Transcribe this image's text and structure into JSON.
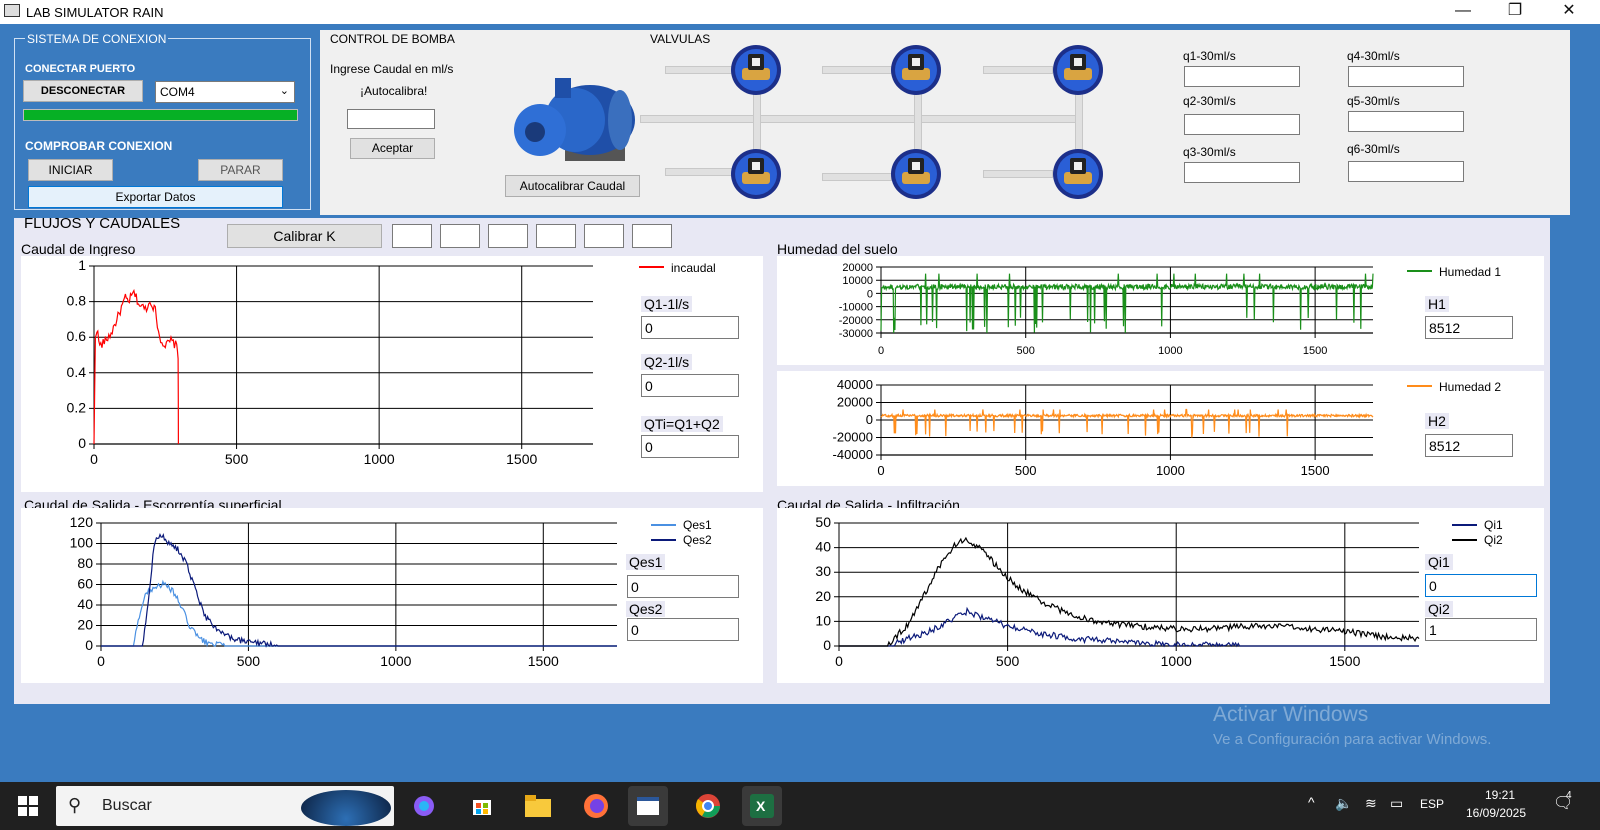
{
  "window": {
    "title": "LAB SIMULATOR RAIN",
    "minimize": "—",
    "restore": "❐",
    "close": "✕"
  },
  "sistema": {
    "group_title": "SISTEMA DE CONEXION",
    "conectar_label": "CONECTAR PUERTO",
    "desconectar_button": "DESCONECTAR",
    "port_selected": "COM4",
    "progress": 1.0,
    "comprobar_label": "COMPROBAR CONEXION",
    "iniciar_button": "INICIAR",
    "parar_button": "PARAR",
    "exportar_button": "Exportar Datos"
  },
  "bomba": {
    "group_title": "CONTROL DE BOMBA",
    "ingrese_label": "Ingrese Caudal en ml/s",
    "autocalibra_label": "¡Autocalibra!",
    "caudal_value": "",
    "aceptar_button": "Aceptar",
    "autocalibrar_button": "Autocalibrar Caudal"
  },
  "valvulas": {
    "group_title": "VALVULAS",
    "labels": [
      "q1-30ml/s",
      "q2-30ml/s",
      "q3-30ml/s",
      "q4-30ml/s",
      "q5-30ml/s",
      "q6-30ml/s"
    ],
    "values": [
      "",
      "",
      "",
      "",
      "",
      ""
    ]
  },
  "flujos": {
    "title": "FLUJOS Y CAUDALES",
    "calibrar_button": "Calibrar K",
    "k_values": [
      "",
      "",
      "",
      "",
      "",
      ""
    ]
  },
  "ingreso": {
    "title": "Caudal de Ingreso",
    "legend": "incaudal",
    "q1_label": "Q1-1l/s",
    "q1_value": "0",
    "q2_label": "Q2-1l/s",
    "q2_value": "0",
    "qt_label": "QTi=Q1+Q2",
    "qt_value": "0"
  },
  "humedad": {
    "title": "Humedad del suelo",
    "legend1": "Humedad 1",
    "h1_label": "H1",
    "h1_value": "8512",
    "legend2": "Humedad 2",
    "h2_label": "H2",
    "h2_value": "8512"
  },
  "escorrentia": {
    "title": "Caudal de Salida - Escorrentía superficial",
    "legend1": "Qes1",
    "legend2": "Qes2",
    "qes1_label": "Qes1",
    "qes1_value": "0",
    "qes2_label": "Qes2",
    "qes2_value": "0"
  },
  "infiltracion": {
    "title": "Caudal de Salida - Infiltración",
    "legend1": "Qi1",
    "legend2": "Qi2",
    "qi1_label": "Qi1",
    "qi1_value": "0",
    "qi2_label": "Qi2",
    "qi2_value": "1"
  },
  "watermark": {
    "line1": "Activar Windows",
    "line2": "Ve a Configuración para activar Windows."
  },
  "taskbar": {
    "search_placeholder": "Buscar",
    "lang": "ESP",
    "time": "19:21",
    "date": "16/09/2025",
    "notif_count": "4"
  },
  "chart_data": [
    {
      "type": "line",
      "title": "Caudal de Ingreso",
      "xlim": [
        0,
        1750
      ],
      "ylim": [
        0,
        1
      ],
      "xticks": [
        0,
        500,
        1000,
        1500
      ],
      "yticks": [
        0,
        0.2,
        0.4,
        0.6,
        0.8,
        1
      ],
      "ytick_labels": [
        "0",
        "0.2",
        "0.4",
        "0.6",
        "0.8",
        "1"
      ],
      "series": [
        {
          "name": "incaudal",
          "color": "#ff0000",
          "x": [
            0,
            5,
            10,
            20,
            40,
            60,
            80,
            100,
            110,
            120,
            140,
            160,
            180,
            200,
            215,
            230,
            250,
            270,
            290,
            295,
            296
          ],
          "y": [
            0,
            0.6,
            0.65,
            0.55,
            0.58,
            0.62,
            0.7,
            0.78,
            0.82,
            0.8,
            0.85,
            0.78,
            0.76,
            0.8,
            0.75,
            0.6,
            0.55,
            0.58,
            0.55,
            0.5,
            0
          ]
        }
      ]
    },
    {
      "type": "line",
      "title": "Humedad 1",
      "xlim": [
        0,
        1700
      ],
      "ylim": [
        -30000,
        20000
      ],
      "xticks": [
        0,
        500,
        1000,
        1500
      ],
      "yticks": [
        -30000,
        -20000,
        -10000,
        0,
        10000,
        20000
      ],
      "ytick_labels": [
        "-30000",
        "-20000",
        "-10000",
        "0",
        "10000",
        "20000"
      ],
      "series": [
        {
          "name": "Humedad 1",
          "color": "#1a8f1a",
          "baseline": 5000,
          "spike_low": -30000,
          "spike_high": 15000
        }
      ]
    },
    {
      "type": "line",
      "title": "Humedad 2",
      "xlim": [
        0,
        1700
      ],
      "ylim": [
        -40000,
        40000
      ],
      "xticks": [
        0,
        500,
        1000,
        1500
      ],
      "yticks": [
        -40000,
        -20000,
        0,
        20000,
        40000
      ],
      "ytick_labels": [
        "-40000",
        "-20000",
        "0",
        "20000",
        "40000"
      ],
      "series": [
        {
          "name": "Humedad 2",
          "color": "#ff8c1a",
          "baseline": 5000,
          "spike_low": -20000,
          "spike_high": 12000
        }
      ]
    },
    {
      "type": "line",
      "title": "Caudal de Salida - Escorrentía superficial",
      "xlim": [
        0,
        1750
      ],
      "ylim": [
        0,
        120
      ],
      "xticks": [
        0,
        500,
        1000,
        1500
      ],
      "yticks": [
        0,
        20,
        40,
        60,
        80,
        100,
        120
      ],
      "ytick_labels": [
        "0",
        "20",
        "40",
        "60",
        "80",
        "100",
        "120"
      ],
      "series": [
        {
          "name": "Qes1",
          "color": "#4a90e2",
          "x": [
            0,
            110,
            130,
            150,
            180,
            210,
            240,
            270,
            300,
            330,
            360,
            420,
            500,
            1750
          ],
          "y": [
            0,
            0,
            30,
            50,
            58,
            60,
            55,
            40,
            20,
            8,
            3,
            0,
            0,
            0
          ]
        },
        {
          "name": "Qes2",
          "color": "#0b1a7a",
          "x": [
            0,
            140,
            160,
            180,
            200,
            230,
            260,
            290,
            320,
            350,
            400,
            450,
            520,
            600,
            1750
          ],
          "y": [
            0,
            0,
            40,
            100,
            110,
            100,
            95,
            80,
            55,
            30,
            15,
            6,
            3,
            0,
            0
          ]
        }
      ]
    },
    {
      "type": "line",
      "title": "Caudal de Salida - Infiltración",
      "xlim": [
        0,
        1720
      ],
      "ylim": [
        0,
        50
      ],
      "xticks": [
        0,
        500,
        1000,
        1500
      ],
      "yticks": [
        0,
        10,
        20,
        30,
        40,
        50
      ],
      "ytick_labels": [
        "0",
        "10",
        "20",
        "30",
        "40",
        "50"
      ],
      "series": [
        {
          "name": "Qi1",
          "color": "#0b1a7a",
          "x": [
            0,
            150,
            200,
            250,
            300,
            350,
            380,
            420,
            500,
            600,
            700,
            800,
            900,
            1000,
            1100,
            1200,
            1720
          ],
          "y": [
            0,
            0,
            3,
            5,
            8,
            12,
            14,
            12,
            8,
            5,
            3,
            2,
            1,
            0.5,
            0.5,
            0,
            0
          ]
        },
        {
          "name": "Qi2",
          "color": "#000000",
          "x": [
            0,
            140,
            200,
            250,
            300,
            350,
            380,
            420,
            470,
            520,
            600,
            700,
            800,
            900,
            1000,
            1100,
            1200,
            1300,
            1400,
            1500,
            1600,
            1720
          ],
          "y": [
            0,
            0,
            8,
            20,
            33,
            42,
            43,
            40,
            32,
            25,
            18,
            12,
            9,
            8,
            7,
            7,
            8,
            8,
            7,
            6,
            4,
            3
          ]
        }
      ]
    }
  ]
}
